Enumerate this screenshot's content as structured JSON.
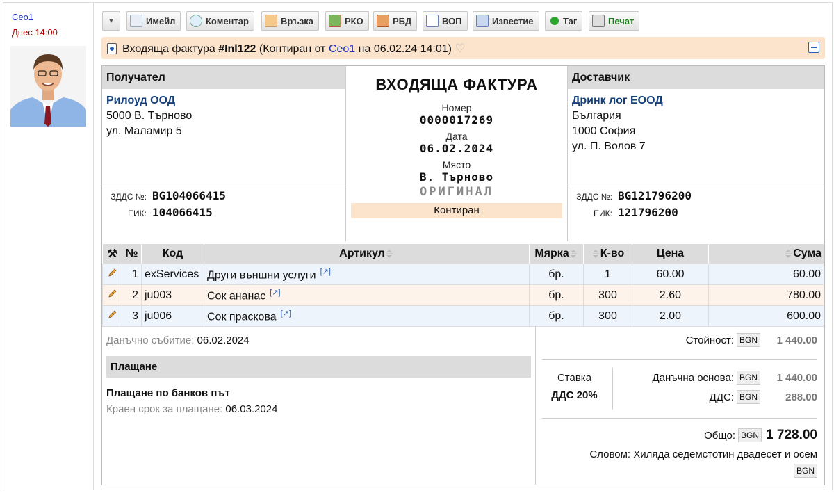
{
  "user": {
    "name": "Ceo1",
    "time": "Днес 14:00"
  },
  "toolbar": {
    "email": "Имейл",
    "comment": "Коментар",
    "link": "Връзка",
    "rko": "РКО",
    "rbd": "РБД",
    "vop": "ВОП",
    "notice": "Известие",
    "tag": "Таг",
    "print": "Печат"
  },
  "header": {
    "title_prefix": "Входяща фактура",
    "doc_id": "#Inl122",
    "state_prefix": "(Контиран от",
    "author": "Ceo1",
    "state_suffix": "на 06.02.24 14:01)"
  },
  "recipient": {
    "heading": "Получател",
    "name": "Рилоуд ООД",
    "line1": "5000 В. Търново",
    "line2": "ул. Маламир 5",
    "vat_label": "ЗДДС №:",
    "vat": "BG104066415",
    "eik_label": "ЕИК:",
    "eik": "104066415"
  },
  "invoice": {
    "title": "ВХОДЯЩА ФАКТУРА",
    "number_label": "Номер",
    "number": "0000017269",
    "date_label": "Дата",
    "date": "06.02.2024",
    "place_label": "Място",
    "place": "В. Търново",
    "original": "ОРИГИНАЛ",
    "status": "Контиран"
  },
  "supplier": {
    "heading": "Доставчик",
    "name": "Дринк лог ЕООД",
    "line1": "България",
    "line2": "1000 София",
    "line3": "ул. П. Волов 7",
    "vat_label": "ЗДДС №:",
    "vat": "BG121796200",
    "eik_label": "ЕИК:",
    "eik": "121796200"
  },
  "items": {
    "columns": {
      "num": "№",
      "code": "Код",
      "article": "Артикул",
      "unit": "Мярка",
      "qty": "К-во",
      "price": "Цена",
      "sum": "Сума"
    },
    "rows": [
      {
        "num": "1",
        "code": "exServices",
        "article": "Други външни услуги",
        "unit": "бр.",
        "qty": "1",
        "price": "60.00",
        "sum": "60.00"
      },
      {
        "num": "2",
        "code": "ju003",
        "article": "Сок ананас",
        "unit": "бр.",
        "qty": "300",
        "price": "2.60",
        "sum": "780.00"
      },
      {
        "num": "3",
        "code": "ju006",
        "article": "Сок праскова",
        "unit": "бр.",
        "qty": "300",
        "price": "2.00",
        "sum": "600.00"
      }
    ]
  },
  "details": {
    "tax_event_label": "Данъчно събитие:",
    "tax_event": "06.02.2024",
    "payment_heading": "Плащане",
    "payment_method": "Плащане по банков път",
    "due_label": "Краен срок за плащане:",
    "due": "06.03.2024"
  },
  "totals": {
    "currency": "BGN",
    "value_label": "Стойност:",
    "value": "1 440.00",
    "rate_label": "Ставка",
    "rate": "ДДС 20%",
    "base_label": "Данъчна основа:",
    "base": "1 440.00",
    "vat_label": "ДДС:",
    "vat": "288.00",
    "total_label": "Общо:",
    "total": "1 728.00",
    "words": "Словом: Хиляда седемстотин двадесет и осем"
  }
}
